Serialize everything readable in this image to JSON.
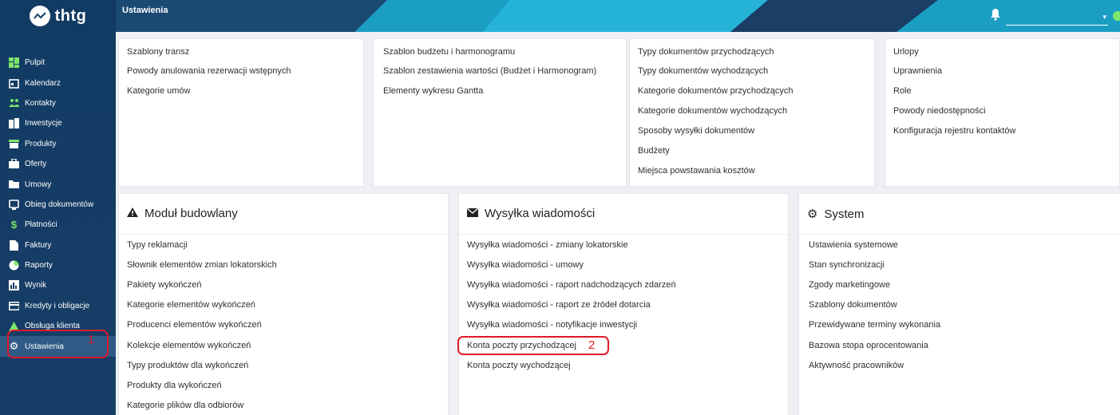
{
  "app": {
    "logo_text": "thtg",
    "header_title": "Ustawienia"
  },
  "colors": {
    "sidebar": "#123b63",
    "header": "#1b9ec4",
    "highlight": "#e0182a"
  },
  "sidebar": {
    "items": [
      {
        "label": "Pulpit",
        "icon": "dashboard-icon"
      },
      {
        "label": "Kalendarz",
        "icon": "calendar-icon"
      },
      {
        "label": "Kontakty",
        "icon": "contacts-icon"
      },
      {
        "label": "Inwestycje",
        "icon": "buildings-icon"
      },
      {
        "label": "Produkty",
        "icon": "store-icon"
      },
      {
        "label": "Oferty",
        "icon": "briefcase-icon"
      },
      {
        "label": "Umowy",
        "icon": "folder-icon"
      },
      {
        "label": "Obieg dokumentów",
        "icon": "document-flow-icon"
      },
      {
        "label": "Płatności",
        "icon": "dollar-icon"
      },
      {
        "label": "Faktury",
        "icon": "invoice-icon"
      },
      {
        "label": "Raporty",
        "icon": "pie-chart-icon"
      },
      {
        "label": "Wynik",
        "icon": "bar-chart-icon"
      },
      {
        "label": "Kredyty i obligacje",
        "icon": "credit-card-icon"
      },
      {
        "label": "Obsługa klienta",
        "icon": "warning-icon"
      },
      {
        "label": "Ustawienia",
        "icon": "gear-icon"
      }
    ],
    "marker": "1"
  },
  "top_cards": [
    {
      "links": [
        "Szablony transz",
        "Powody anulowania rezerwacji wstępnych",
        "Kategorie umów"
      ]
    },
    {
      "links": [
        "Szablon budżetu i harmonogramu",
        "Szablon zestawienia wartości (Budżet i Harmonogram)",
        "Elementy wykresu Gantta"
      ]
    },
    {
      "links": [
        "Typy dokumentów przychodzących",
        "Typy dokumentów wychodzących",
        "Kategorie dokumentów przychodzących",
        "Kategorie dokumentów wychodzących",
        "Sposoby wysyłki dokumentów",
        "Budżety",
        "Miejsca powstawania kosztów"
      ]
    },
    {
      "links": [
        "Urlopy",
        "Uprawnienia",
        "Role",
        "Powody niedostępności",
        "Konfiguracja rejestru kontaktów"
      ]
    }
  ],
  "sections": {
    "building": {
      "title": "Moduł budowlany",
      "links": [
        "Typy reklamacji",
        "Słownik elementów zmian lokatorskich",
        "Pakiety wykończeń",
        "Kategorie elementów wykończeń",
        "Producenci elementów wykończeń",
        "Kolekcje elementów wykończeń",
        "Typy produktów dla wykończeń",
        "Produkty dla wykończeń",
        "Kategorie plików dla odbiorów"
      ]
    },
    "messages": {
      "title": "Wysyłka wiadomości",
      "links": [
        "Wysyłka wiadomości - zmiany lokatorskie",
        "Wysyłka wiadomości - umowy",
        "Wysyłka wiadomości - raport nadchodzących zdarzeń",
        "Wysyłka wiadomości - raport ze źródeł dotarcia",
        "Wysyłka wiadomości - notyfikacje inwestycji",
        "Konta poczty przychodzącej",
        "Konta poczty wychodzącej"
      ],
      "marker": "2"
    },
    "system": {
      "title": "System",
      "links": [
        "Ustawienia systemowe",
        "Stan synchronizacji",
        "Zgody marketingowe",
        "Szablony dokumentów",
        "Przewidywane terminy wykonania",
        "Bazowa stopa oprocentowania",
        "Aktywność pracowników"
      ]
    }
  }
}
